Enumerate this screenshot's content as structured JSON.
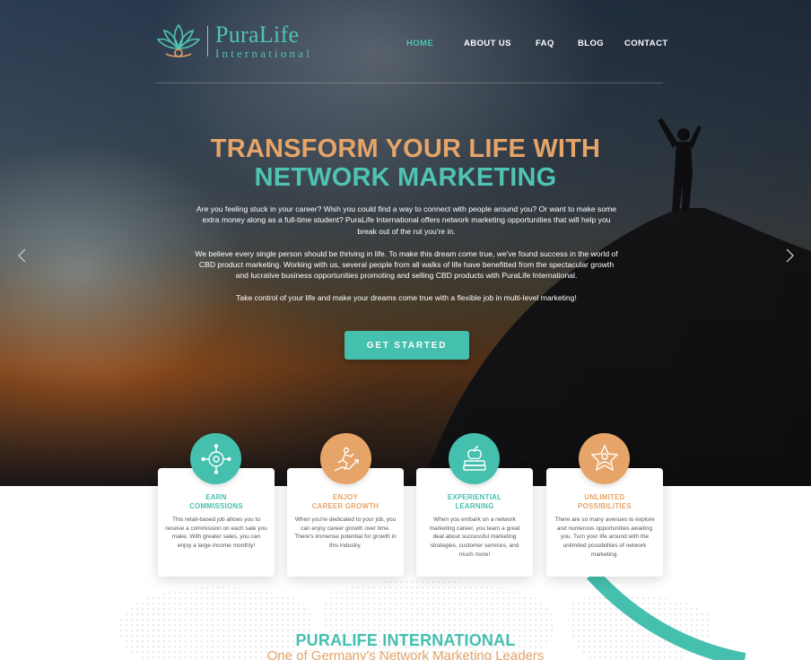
{
  "brand": {
    "name": "PuraLife",
    "sub": "International"
  },
  "nav": {
    "items": [
      "HOME",
      "ABOUT US",
      "FAQ",
      "BLOG",
      "CONTACT"
    ],
    "active": "HOME"
  },
  "hero": {
    "title_line1": "TRANSFORM YOUR LIFE WITH",
    "title_line2": "NETWORK MARKETING",
    "paragraphs": [
      "Are you feeling stuck in your career? Wish you could find a way to connect with people around you? Or want to make some extra money along as a full-time student? PuraLife International offers network marketing opportunities that will help you break out of the rut you're in.",
      "We believe every single person should be thriving in life. To make this dream come true, we've found success in the world of CBD product marketing. Working with us, several people from all walks of life have benefitted from the spectacular growth and lucrative business opportunities promoting and selling CBD products with PuraLife International.",
      "Take control of your life and make your dreams come true with a flexible job in multi-level marketing!"
    ],
    "cta": "GET STARTED"
  },
  "features": [
    {
      "title_line1": "EARN",
      "title_line2": "COMMISSIONS",
      "text": "This retail-based job allows you to receive a commission on each sale you make. With greater sales, you can enjoy a large income monthly!",
      "icon": "target-icon",
      "color": "#45bfae"
    },
    {
      "title_line1": "ENJOY",
      "title_line2": "CAREER GROWTH",
      "text": "When you're dedicated to your job, you can enjoy career growth over time. There's immense potential for growth in this industry.",
      "icon": "running-growth-icon",
      "color": "#e6a468"
    },
    {
      "title_line1": "EXPERIENTIAL",
      "title_line2": "LEARNING",
      "text": "When you embark on a network marketing career, you learn a great deal about successful marketing strategies, customer services, and much more!",
      "icon": "books-apple-icon",
      "color": "#45bfae"
    },
    {
      "title_line1": "UNLIMITED",
      "title_line2": "POSSIBILITIES",
      "text": "There are so many avenues to explore and numerous opportunities awaiting you. Turn your life around with the unlimited possibilities of network marketing.",
      "icon": "star-person-icon",
      "color": "#e6a468"
    }
  ],
  "about": {
    "title": "PURALIFE INTERNATIONAL",
    "subtitle": "One of Germany's Network Marketing Leaders"
  },
  "colors": {
    "teal": "#45bfae",
    "orange": "#e6a468"
  }
}
